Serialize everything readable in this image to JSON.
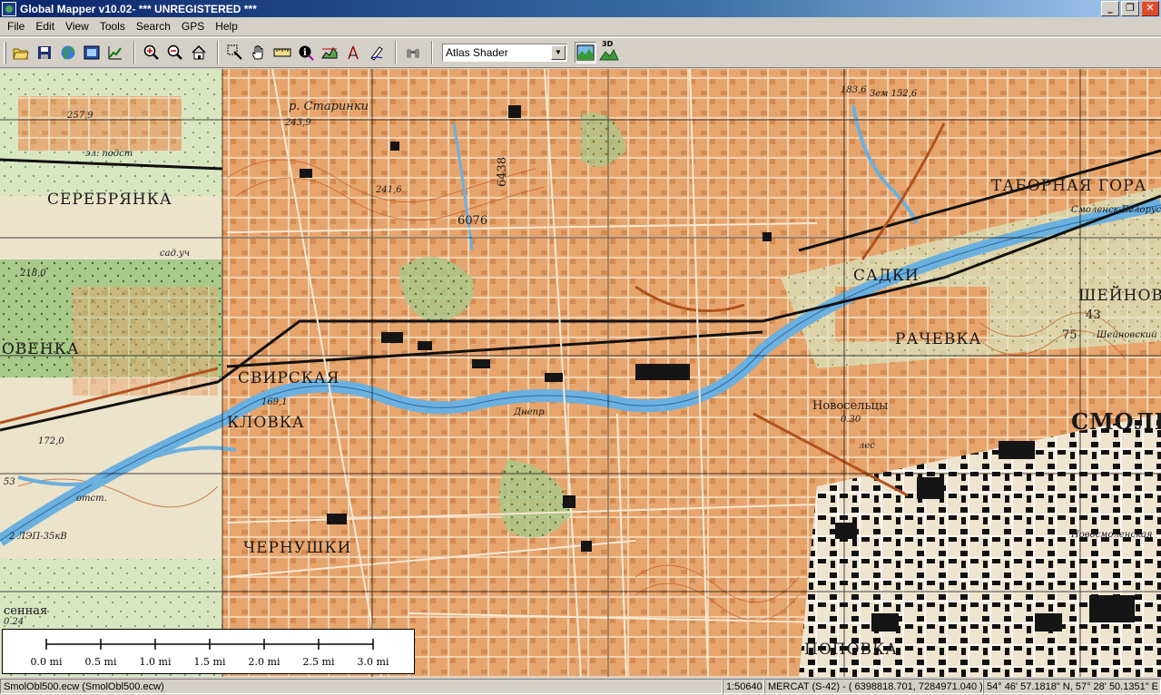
{
  "window": {
    "title": "Global Mapper v10.02- *** UNREGISTERED ***",
    "minimize": "_",
    "maximize": "❐",
    "close": "✕"
  },
  "menu": [
    "File",
    "Edit",
    "View",
    "Tools",
    "Search",
    "GPS",
    "Help"
  ],
  "toolbar": {
    "icons": [
      "open-folder-icon",
      "save-icon",
      "globe-icon",
      "config-icon",
      "digitizer-icon",
      "zoom-in-icon",
      "zoom-out-icon",
      "home-icon",
      "zoom-box-icon",
      "pan-hand-icon",
      "measure-icon",
      "info-icon",
      "path-profile-icon",
      "view-shed-icon",
      "digitize-icon",
      "binoculars-icon",
      "shader-icon",
      "3d-view-icon"
    ],
    "shader_value": "Atlas Shader",
    "btn_3d": "3D"
  },
  "map": {
    "labels": {
      "serebryanka": "СЕРЕБРЯНКА",
      "ovenka": "ОВЕНКА",
      "svirskaya": "СВИРСКАЯ",
      "klovka": "КЛОВКА",
      "chernushki": "ЧЕРНУШКИ",
      "sadki": "САДКИ",
      "rachevka": "РАЧЕВКА",
      "tabornaya": "ТАБОРНАЯ ГОРА",
      "sheinovka": "ШЕЙНОВК",
      "smolensk": "СМОЛЕ",
      "popovka": "ПОПОВКА",
      "novoseltsy": "Новосельцы",
      "novoseltsy_h": "0.30",
      "starinki": "р. Старинки",
      "grid6076": "6076",
      "grid6438": "6438",
      "el_post": "эл. подст",
      "dnepr": "Днепр",
      "sennaya": "сенная",
      "sennaya_h": "0.24",
      "h257": "257,9",
      "h218": "218,0",
      "h172": "172,0",
      "h183": "183,6",
      "h241": "241,6",
      "h243": "243,9",
      "h169": "169,1",
      "h43": "43",
      "h75": "75",
      "sadachi": "сад.уч",
      "smolensk_bel": "Смоленск-Белорусс",
      "novosmol": "Новосмоленская",
      "lesn": "лес",
      "karier": "Шейновский карьер",
      "otst": "отст.",
      "lep": "2 ЛЭП-35кВ",
      "zem": "Зем 152,6",
      "h53": "53"
    }
  },
  "scalebar": {
    "labels": [
      "0.0 mi",
      "0.5 mi",
      "1.0 mi",
      "1.5 mi",
      "2.0 mi",
      "2.5 mi",
      "3.0 mi"
    ]
  },
  "status": {
    "file": "SmolObl500.ecw (SmolObl500.ecw)",
    "scale": "1:50640",
    "projection": "MERCAT (S-42) - ( 6398818.701, 7284971.040 )",
    "latlon": "54° 46' 57.1818\" N, 57° 28' 50.1351\" E"
  },
  "colors": {
    "urban": "#e7a56e",
    "river": "#6cb0de",
    "forest": "#9cc27a",
    "blocks": "#151515"
  }
}
